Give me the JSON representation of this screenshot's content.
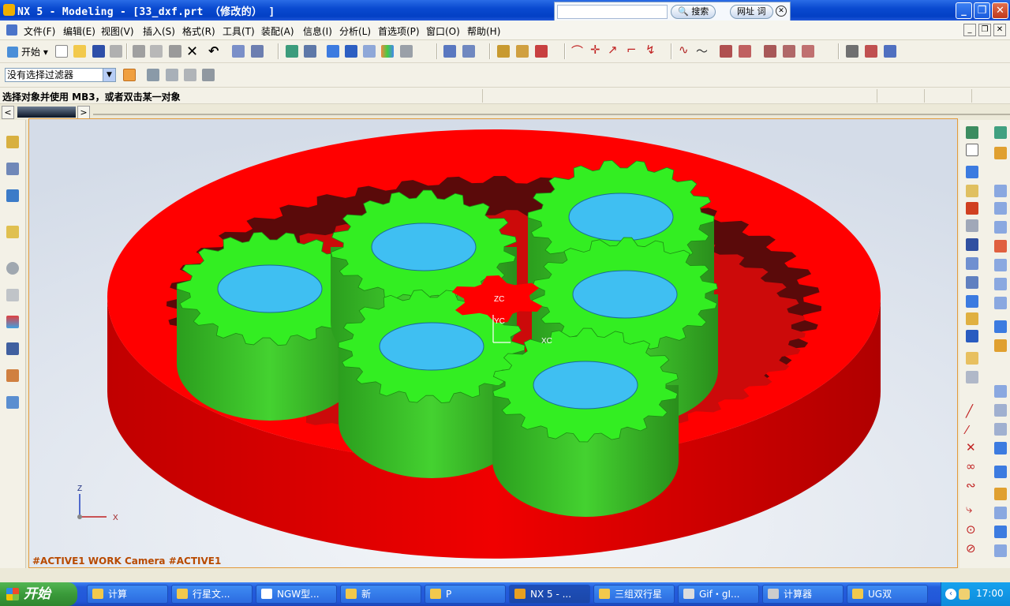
{
  "window": {
    "title": "NX 5 - Modeling - [33_dxf.prt （修改的） ]"
  },
  "search": {
    "btn_search": "搜索",
    "btn_url": "网址",
    "btn_word": "词"
  },
  "menu": {
    "items": [
      "文件(F)",
      "编辑(E)",
      "视图(V)",
      "插入(S)",
      "格式(R)",
      "工具(T)",
      "装配(A)",
      "信息(I)",
      "分析(L)",
      "首选项(P)",
      "窗口(O)",
      "帮助(H)"
    ]
  },
  "toolbar": {
    "start_label": "开始"
  },
  "filter": {
    "value": "没有选择过滤器"
  },
  "status": {
    "prompt": "选择对象并使用 MB3，或者双击某一对象"
  },
  "viewport": {
    "camera_label": "#ACTIVE1 WORK Camera #ACTIVE1",
    "axis_zc": "ZC",
    "axis_yc": "YC",
    "axis_xc": "XC",
    "triad_z": "Z",
    "triad_x": "X",
    "colors": {
      "ring_gear": "#FF0000",
      "planet_gear": "#33EE22",
      "bore": "#3FBFF2",
      "background": "#E6ECF3"
    }
  },
  "taskbar": {
    "start": "开始",
    "tasks": [
      "计算",
      "行星文...",
      "NGW型...",
      "新",
      "P",
      "NX 5 - ...",
      "三组双行星",
      "Gif・gI...",
      "计算器",
      "UG双"
    ],
    "clock": "17:00"
  }
}
